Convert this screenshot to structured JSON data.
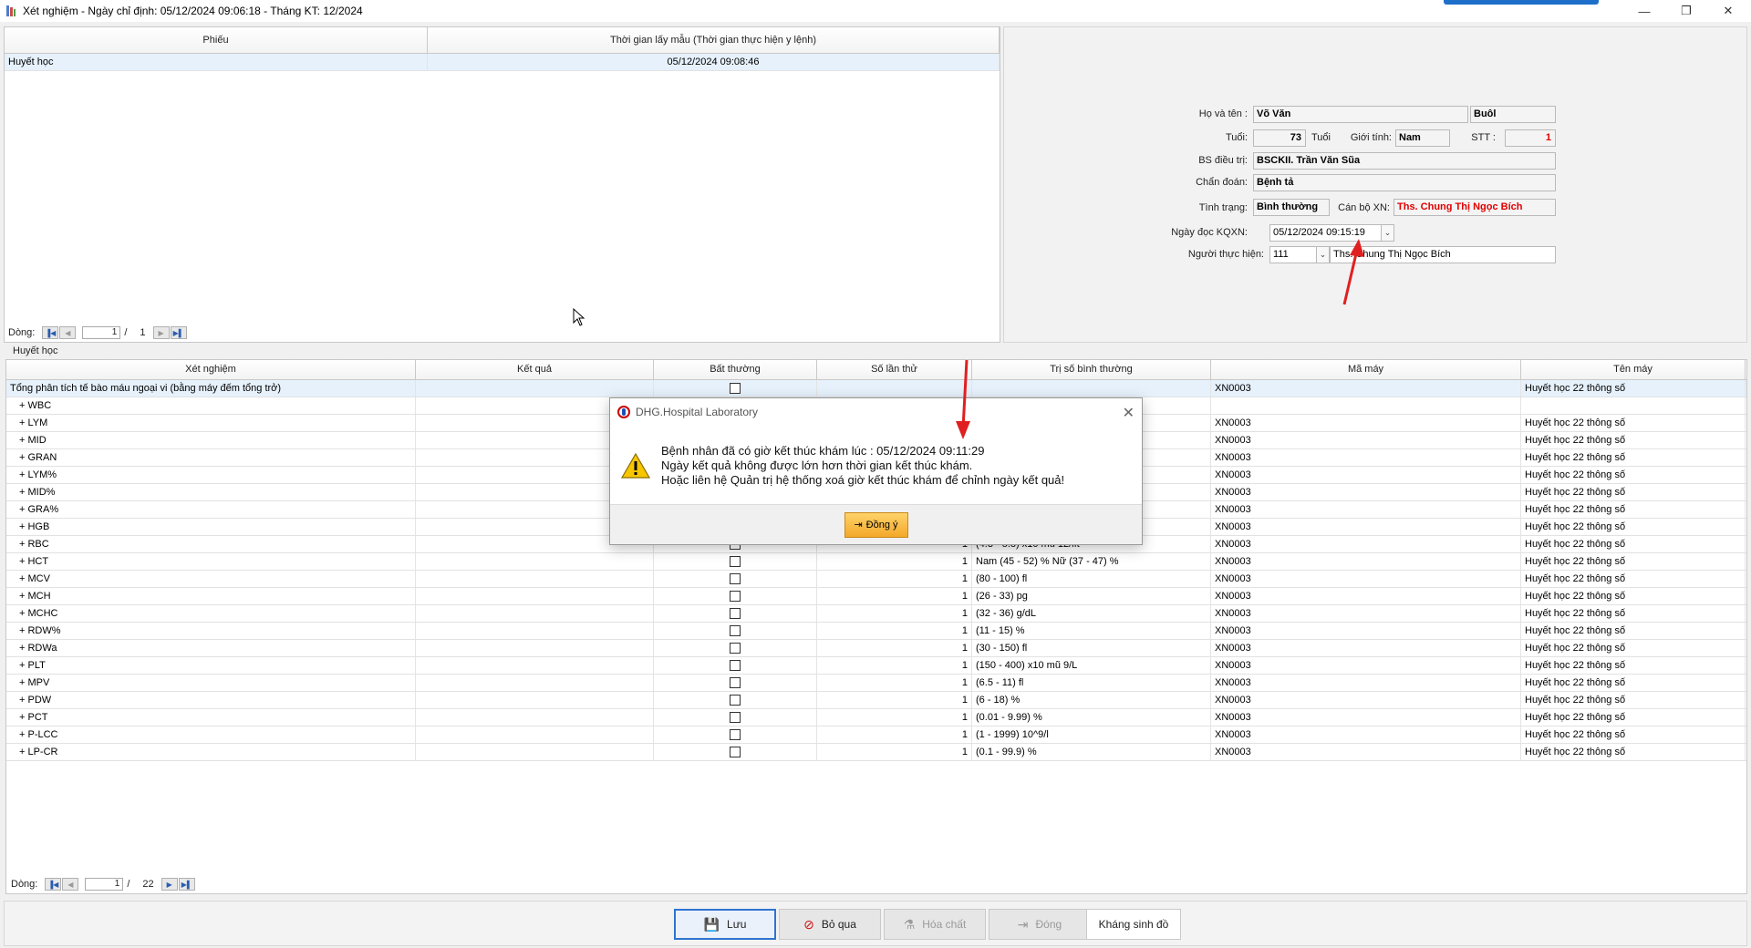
{
  "window": {
    "title": "Xét nghiệm - Ngày chỉ định: 05/12/2024 09:06:18 - Tháng KT: 12/2024",
    "minimize": "—",
    "restore": "❐",
    "close": "✕"
  },
  "top_grid": {
    "headers": [
      "Phiếu",
      "Thời gian lấy mẫu (Thời gian thực hiện y lệnh)"
    ],
    "rows": [
      {
        "phieu": "Huyết học",
        "time": "05/12/2024 09:08:46"
      }
    ],
    "nav": {
      "label": "Dòng:",
      "current": "1",
      "sep": "/",
      "total": "1"
    }
  },
  "patient": {
    "name_label": "Họ và tên :",
    "name": "Võ Văn",
    "name2": "Buôl",
    "age_label": "Tuổi:",
    "age": "73",
    "age_unit": "Tuổi",
    "gender_label": "Giới tính:",
    "gender": "Nam",
    "stt_label": "STT :",
    "stt": "1",
    "doctor_label": "BS điều trị:",
    "doctor": "BSCKII. Trần Văn Sũa",
    "diagnosis_label": "Chẩn đoán:",
    "diagnosis": "Bệnh tả",
    "status_label": "Tình trạng:",
    "status": "Bình thường",
    "staff_label": "Cán bộ XN:",
    "staff": "Ths. Chung Thị Ngọc Bích",
    "readdate_label": "Ngày đọc KQXN:",
    "readdate": "05/12/2024  09:15:19",
    "performer_label": "Người thực hiện:",
    "performer_code": "111",
    "performer_name": "Ths. Chung Thị Ngọc Bích"
  },
  "section_label": "Huyết học",
  "results_grid": {
    "headers": [
      "Xét nghiệm",
      "Kết quả",
      "Bất thường",
      "Số lần thử",
      "Trị số bình thường",
      "Mã máy",
      "Tên máy"
    ],
    "rows": [
      {
        "test": "Tổng phân tích tế bào máu ngoại vi (bằng máy đếm tổng trở)",
        "check": true,
        "count": "",
        "normal": "",
        "machine": "XN0003",
        "machine_name": "Huyết học 22 thông số"
      },
      {
        "test": "+ WBC",
        "check": false,
        "count": "",
        "normal": "",
        "machine": "",
        "machine_name": ""
      },
      {
        "test": "+ LYM",
        "check": false,
        "count": "",
        "normal": "",
        "machine": "XN0003",
        "machine_name": "Huyết học 22 thông số"
      },
      {
        "test": "+ MID",
        "check": false,
        "count": "",
        "normal": "",
        "machine": "XN0003",
        "machine_name": "Huyết học 22 thông số"
      },
      {
        "test": "+ GRAN",
        "check": false,
        "count": "",
        "normal": "",
        "machine": "XN0003",
        "machine_name": "Huyết học 22 thông số"
      },
      {
        "test": "+ LYM%",
        "check": false,
        "count": "",
        "normal": "",
        "machine": "XN0003",
        "machine_name": "Huyết học 22 thông số"
      },
      {
        "test": "+ MID%",
        "check": false,
        "count": "",
        "normal": "",
        "machine": "XN0003",
        "machine_name": "Huyết học 22 thông số"
      },
      {
        "test": "+ GRA%",
        "check": false,
        "count": "",
        "normal": "",
        "machine": "XN0003",
        "machine_name": "Huyết học 22 thông số"
      },
      {
        "test": "+ HGB",
        "check": false,
        "count": "",
        "normal": "",
        "machine": "XN0003",
        "machine_name": "Huyết học 22 thông số"
      },
      {
        "test": "+ RBC",
        "check": true,
        "count": "1",
        "normal": "(4.3 - 5.8) x10 mũ 12/lít",
        "machine": "XN0003",
        "machine_name": "Huyết học 22 thông số"
      },
      {
        "test": "+ HCT",
        "check": true,
        "count": "1",
        "normal": "Nam (45 - 52) %  Nữ (37 - 47) %",
        "machine": "XN0003",
        "machine_name": "Huyết học 22 thông số"
      },
      {
        "test": "+ MCV",
        "check": true,
        "count": "1",
        "normal": "(80 - 100) fl",
        "machine": "XN0003",
        "machine_name": "Huyết học 22 thông số"
      },
      {
        "test": "+ MCH",
        "check": true,
        "count": "1",
        "normal": "(26 - 33) pg",
        "machine": "XN0003",
        "machine_name": "Huyết học 22 thông số"
      },
      {
        "test": "+ MCHC",
        "check": true,
        "count": "1",
        "normal": "(32 - 36) g/dL",
        "machine": "XN0003",
        "machine_name": "Huyết học 22 thông số"
      },
      {
        "test": "+ RDW%",
        "check": true,
        "count": "1",
        "normal": "(11 - 15) %",
        "machine": "XN0003",
        "machine_name": "Huyết học 22 thông số"
      },
      {
        "test": "+ RDWa",
        "check": true,
        "count": "1",
        "normal": "(30 - 150) fl",
        "machine": "XN0003",
        "machine_name": "Huyết học 22 thông số"
      },
      {
        "test": "+ PLT",
        "check": true,
        "count": "1",
        "normal": "(150 - 400) x10 mũ 9/L",
        "machine": "XN0003",
        "machine_name": "Huyết học 22 thông số"
      },
      {
        "test": "+ MPV",
        "check": true,
        "count": "1",
        "normal": "(6.5 - 11) fl",
        "machine": "XN0003",
        "machine_name": "Huyết học 22 thông số"
      },
      {
        "test": "+ PDW",
        "check": true,
        "count": "1",
        "normal": "(6 - 18) %",
        "machine": "XN0003",
        "machine_name": "Huyết học 22 thông số"
      },
      {
        "test": "+ PCT",
        "check": true,
        "count": "1",
        "normal": "(0.01 - 9.99) %",
        "machine": "XN0003",
        "machine_name": "Huyết học 22 thông số"
      },
      {
        "test": "+ P-LCC",
        "check": true,
        "count": "1",
        "normal": "(1 - 1999) 10^9/l",
        "machine": "XN0003",
        "machine_name": "Huyết học 22 thông số"
      },
      {
        "test": "+ LP-CR",
        "check": true,
        "count": "1",
        "normal": "(0.1 - 99.9) %",
        "machine": "XN0003",
        "machine_name": "Huyết học 22 thông số"
      }
    ],
    "nav": {
      "label": "Dòng:",
      "current": "1",
      "sep": "/",
      "total": "22"
    }
  },
  "dialog": {
    "title": "DHG.Hospital Laboratory",
    "line1": "Bệnh nhân đã có giờ kết thúc khám lúc : 05/12/2024 09:11:29",
    "line2": "Ngày kết quả không được lớn hơn thời gian kết thúc khám.",
    "line3": "Hoặc liên hệ Quản trị hệ thống xoá giờ kết thúc khám để chỉnh ngày kết quả!",
    "ok": "Đồng ý",
    "close": "✕"
  },
  "buttons": {
    "save": "Lưu",
    "skip": "Bỏ qua",
    "chemicals": "Hóa chất",
    "close": "Đóng",
    "antibiotic": "Kháng sinh đồ"
  },
  "colors": {
    "red_text": "#e00000",
    "selected_row": "#e6f1fb",
    "primary_border": "#2f74d0",
    "annotation_arrow": "#e02020"
  }
}
